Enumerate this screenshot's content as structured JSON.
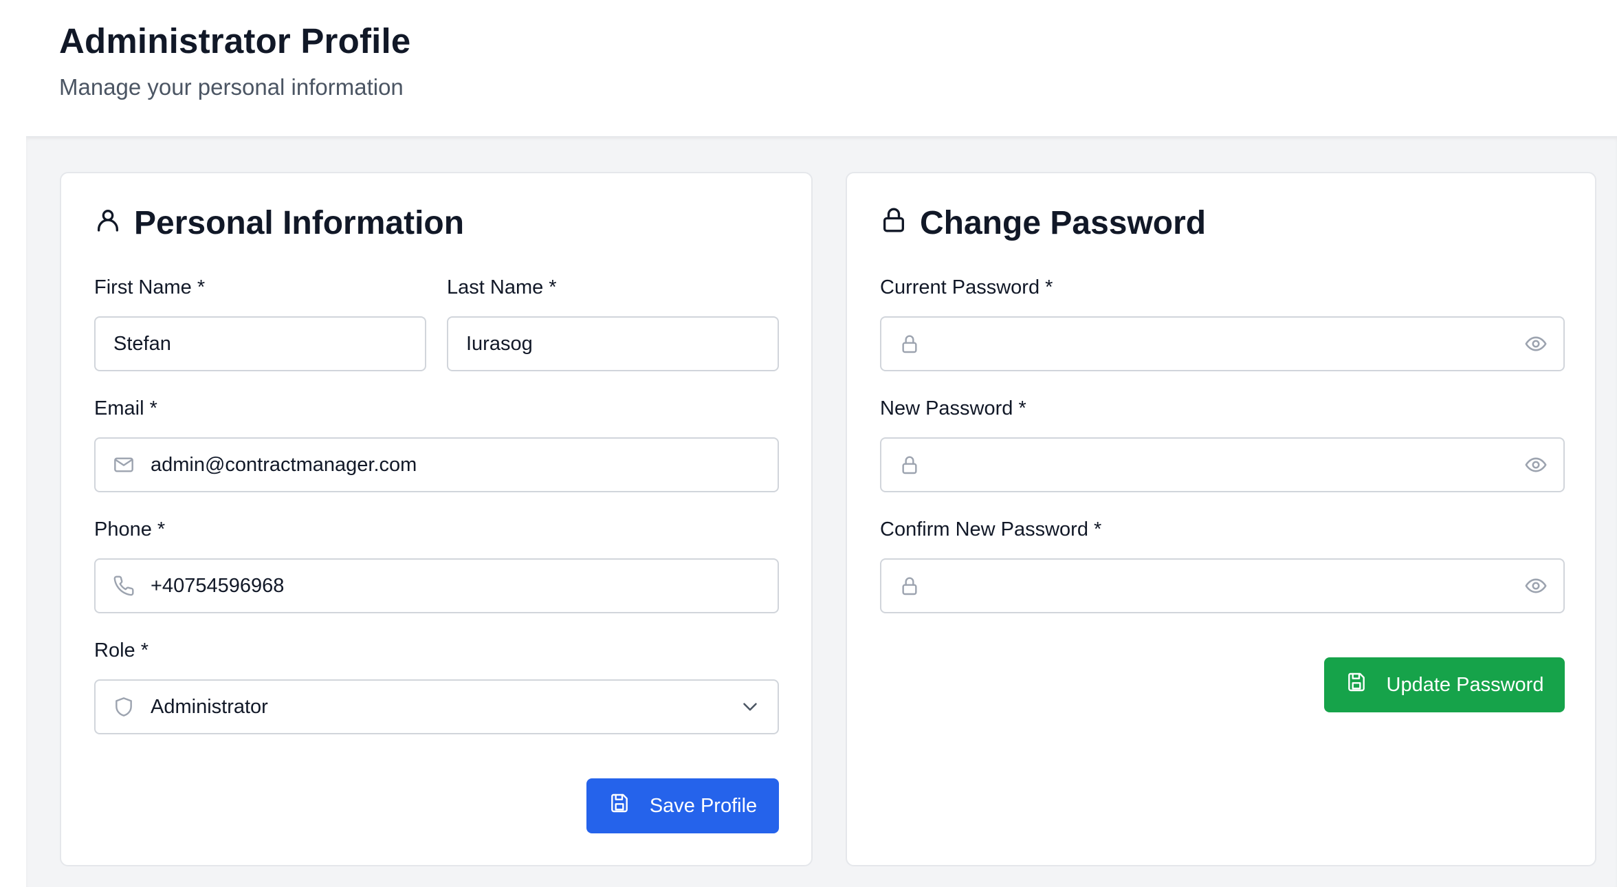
{
  "header": {
    "title": "Administrator Profile",
    "subtitle": "Manage your personal information"
  },
  "personal": {
    "title": "Personal Information",
    "first_name_label": "First Name *",
    "first_name_value": "Stefan",
    "last_name_label": "Last Name *",
    "last_name_value": "Iurasog",
    "email_label": "Email *",
    "email_value": "admin@contractmanager.com",
    "phone_label": "Phone *",
    "phone_value": "+40754596968",
    "role_label": "Role *",
    "role_value": "Administrator",
    "save_label": "Save Profile"
  },
  "password": {
    "title": "Change Password",
    "current_label": "Current Password *",
    "new_label": "New Password *",
    "confirm_label": "Confirm New Password *",
    "update_label": "Update Password"
  },
  "colors": {
    "primary_button": "#2563eb",
    "success_button": "#16a34a",
    "content_background": "#f3f4f6"
  },
  "icons": {
    "personal_title": "user-icon",
    "password_title": "lock-icon",
    "email": "mail-icon",
    "phone": "phone-icon",
    "role": "shield-icon",
    "role_dropdown": "chevron-down-icon",
    "password_field": "lock-icon",
    "password_toggle": "eye-icon",
    "save": "save-icon"
  }
}
